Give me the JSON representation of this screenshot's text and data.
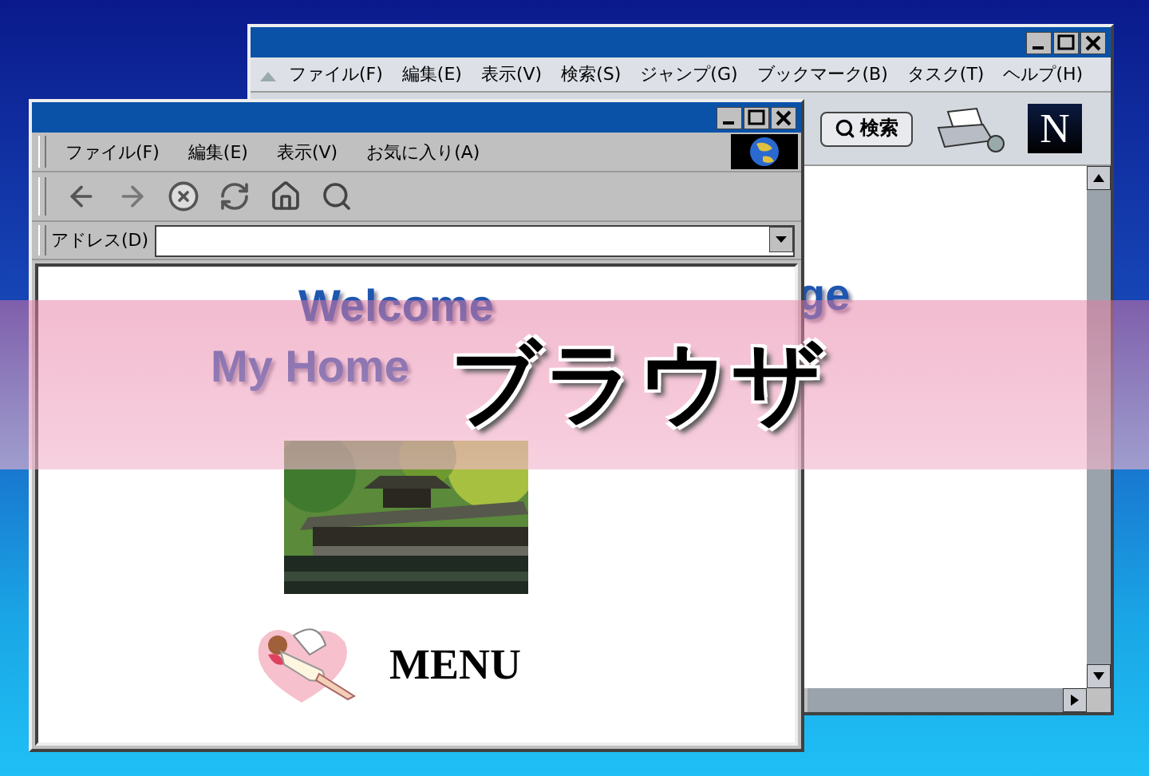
{
  "back_window": {
    "menu": [
      "ファイル(F)",
      "編集(E)",
      "表示(V)",
      "検索(S)",
      "ジャンプ(G)",
      "ブックマーク(B)",
      "タスク(T)",
      "ヘルプ(H)"
    ],
    "search_button": "検索",
    "logo_letter": "N",
    "content_text": "ge"
  },
  "front_window": {
    "menu": [
      "ファイル(F)",
      "編集(E)",
      "表示(V)",
      "お気に入り(A)"
    ],
    "address_label": "アドレス(D)",
    "heading": [
      "Welcome",
      "My Home"
    ],
    "menu_label": "MENU"
  },
  "banner": {
    "title": "ブラウザ"
  }
}
